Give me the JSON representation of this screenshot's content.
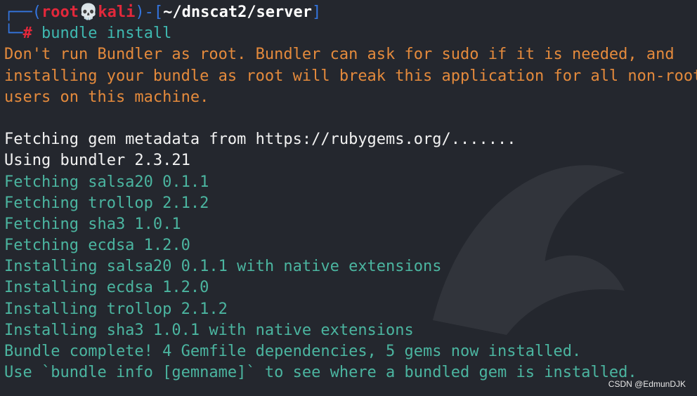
{
  "prompt": {
    "frame_open": "┌──(",
    "user": "root",
    "skull": "💀",
    "host": "kali",
    "frame_mid": ")-[",
    "path": "~/dnscat2/server",
    "frame_close": "]",
    "second_prefix": "└─",
    "hash": "#",
    "command": " bundle install"
  },
  "output": {
    "warning": [
      "Don't run Bundler as root. Bundler can ask for sudo if it is needed, and",
      "installing your bundle as root will break this application for all non-root",
      "users on this machine."
    ],
    "blank": "",
    "plain": [
      "Fetching gem metadata from https://rubygems.org/.......",
      "Using bundler 2.3.21"
    ],
    "green": [
      "Fetching salsa20 0.1.1",
      "Fetching trollop 2.1.2",
      "Fetching sha3 1.0.1",
      "Fetching ecdsa 1.2.0",
      "Installing salsa20 0.1.1 with native extensions",
      "Installing ecdsa 1.2.0",
      "Installing trollop 2.1.2",
      "Installing sha3 1.0.1 with native extensions",
      "Bundle complete! 4 Gemfile dependencies, 5 gems now installed.",
      "Use `bundle info [gemname]` to see where a bundled gem is installed."
    ]
  },
  "watermark": "CSDN @EdmunDJK",
  "colors": {
    "background": "#24272e",
    "prompt_frame": "#3476e0",
    "prompt_user": "#e2283b",
    "command": "#3fb8b0",
    "warning": "#e48a3c",
    "success": "#4bb5a0"
  }
}
